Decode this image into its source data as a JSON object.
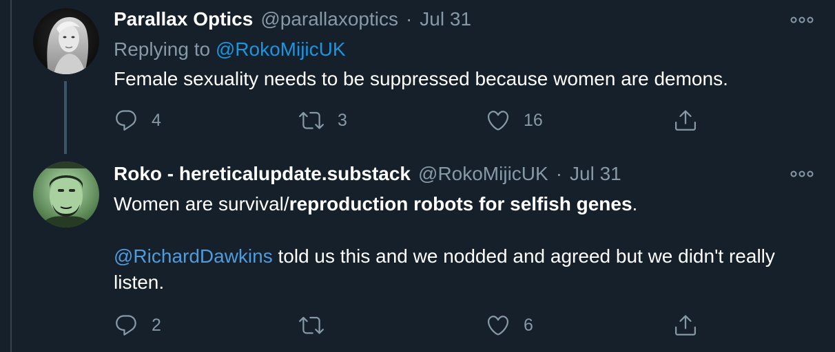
{
  "tweets": [
    {
      "display_name": "Parallax Optics",
      "handle": "@parallaxoptics",
      "separator": "·",
      "date": "Jul 31",
      "reply_prefix": "Replying to",
      "reply_to": "@RokoMijicUK",
      "text": "Female sexuality needs to be suppressed because women are demons.",
      "stats": {
        "replies": "4",
        "retweets": "3",
        "likes": "16"
      }
    },
    {
      "display_name": "Roko - hereticalupdate.substack",
      "handle": "@RokoMijicUK",
      "separator": "·",
      "date": "Jul 31",
      "text_plain": "Women are survival/",
      "text_bold": "reproduction robots for selfish genes",
      "text_end": ".",
      "mention": "@RichardDawkins",
      "text_rest": " told us this and we nodded and agreed but we didn't really listen.",
      "stats": {
        "replies": "2",
        "retweets": "",
        "likes": "6"
      }
    }
  ],
  "icons": {
    "reply": "reply-icon",
    "retweet": "retweet-icon",
    "like": "heart-icon",
    "share": "share-icon",
    "more": "more-options-icon"
  },
  "colors": {
    "background": "#15202b",
    "secondary_text": "#8899a6",
    "link": "#1b95e0",
    "thread_line": "#3d5466"
  }
}
